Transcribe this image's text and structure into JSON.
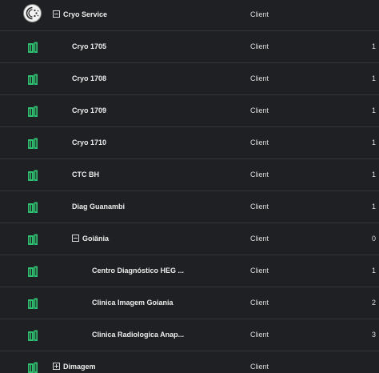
{
  "colors": {
    "background": "#1f2023",
    "row_divider": "#34363b",
    "building_icon": "#2fbf71",
    "text": "#ececec"
  },
  "rows": [
    {
      "name": "Cryo Service",
      "type": "Client",
      "count": "",
      "icon": "avatar-icon",
      "toggle": "minus"
    },
    {
      "name": "Cryo 1705",
      "type": "Client",
      "count": "1",
      "icon": "building-icon",
      "toggle": ""
    },
    {
      "name": "Cryo 1708",
      "type": "Client",
      "count": "1",
      "icon": "building-icon",
      "toggle": ""
    },
    {
      "name": "Cryo 1709",
      "type": "Client",
      "count": "1",
      "icon": "building-icon",
      "toggle": ""
    },
    {
      "name": "Cryo 1710",
      "type": "Client",
      "count": "1",
      "icon": "building-icon",
      "toggle": ""
    },
    {
      "name": "CTC BH",
      "type": "Client",
      "count": "1",
      "icon": "building-icon",
      "toggle": ""
    },
    {
      "name": "Diag Guanambi",
      "type": "Client",
      "count": "1",
      "icon": "building-icon",
      "toggle": ""
    },
    {
      "name": "Goiânia",
      "type": "Client",
      "count": "0",
      "icon": "building-icon",
      "toggle": "minus"
    },
    {
      "name": "Centro Diagnóstico HEG ...",
      "type": "Client",
      "count": "1",
      "icon": "building-icon",
      "toggle": ""
    },
    {
      "name": "Clinica Imagem Goiania",
      "type": "Client",
      "count": "2",
      "icon": "building-icon",
      "toggle": ""
    },
    {
      "name": "Clinica Radiologica Anap...",
      "type": "Client",
      "count": "3",
      "icon": "building-icon",
      "toggle": ""
    },
    {
      "name": "Dimagem",
      "type": "Client",
      "count": "",
      "icon": "building-icon",
      "toggle": "plus"
    }
  ]
}
